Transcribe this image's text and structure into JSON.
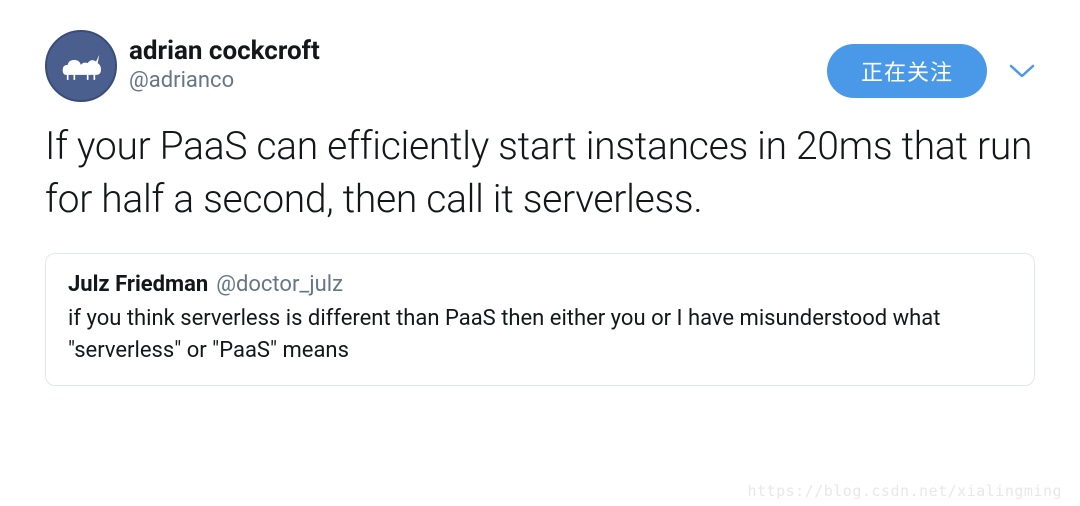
{
  "user": {
    "display_name": "adrian cockcroft",
    "handle": "@adrianco"
  },
  "actions": {
    "follow_label": "正在关注"
  },
  "tweet": {
    "text": "If your PaaS can efficiently start instances in 20ms that run for half a second, then call it serverless."
  },
  "quoted": {
    "display_name": "Julz Friedman",
    "handle": "@doctor_julz",
    "text": "if you think serverless is different than PaaS then either you or I have misunderstood what \"serverless\" or \"PaaS\" means"
  },
  "watermark": "https://blog.csdn.net/xialingming"
}
